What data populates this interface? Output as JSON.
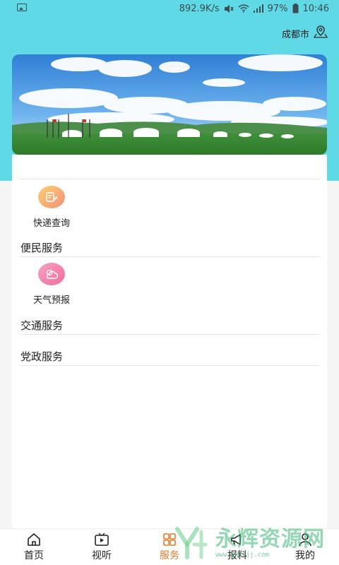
{
  "status_bar": {
    "net_speed": "892.9K/s",
    "battery": "97%",
    "time": "10:46"
  },
  "location": {
    "city": "成都市",
    "icon": "location-pin-icon"
  },
  "sections": {
    "express": {
      "label": "快递查询",
      "icon": "express-note-icon",
      "color": "#f6a25c"
    },
    "convenience": {
      "title": "便民服务"
    },
    "weather": {
      "label": "天气预报",
      "icon": "cloud-sun-icon",
      "color": "#f07aa2"
    },
    "traffic": {
      "title": "交通服务"
    },
    "party": {
      "title": "党政服务"
    }
  },
  "tabs": [
    {
      "label": "首页",
      "icon": "home-icon"
    },
    {
      "label": "视听",
      "icon": "video-icon"
    },
    {
      "label": "服务",
      "icon": "service-grid-icon",
      "active": true
    },
    {
      "label": "报料",
      "icon": "megaphone-icon"
    },
    {
      "label": "我的",
      "icon": "user-icon"
    }
  ],
  "watermark": {
    "text": "永辉资源网",
    "url": "www.yhkjjj.com"
  },
  "colors": {
    "header": "#5fd9e6",
    "accent": "#e07b2c"
  }
}
